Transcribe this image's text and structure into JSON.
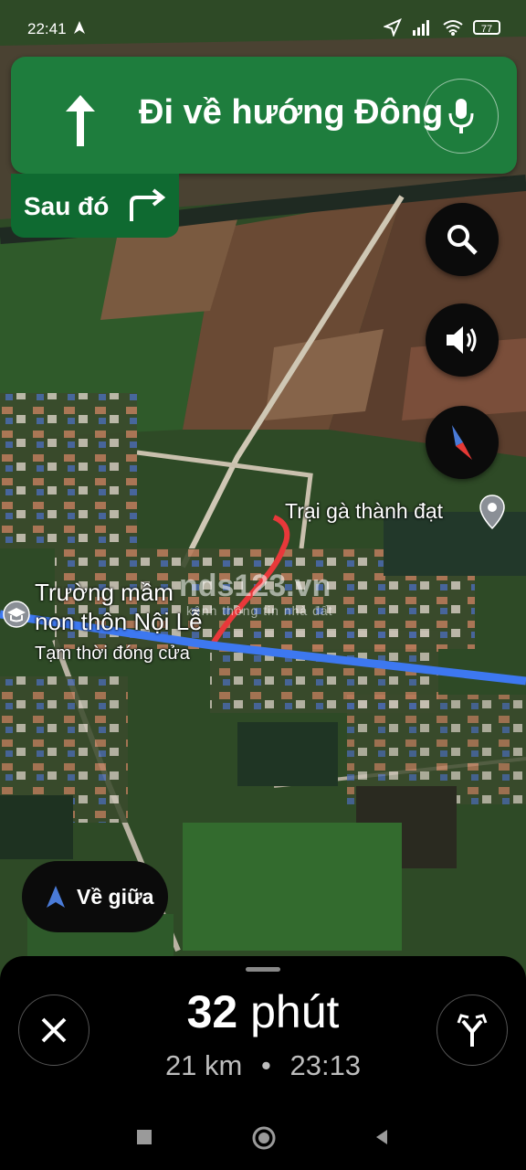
{
  "status_bar": {
    "time": "22:41",
    "battery": "77"
  },
  "banner": {
    "instruction": "Đi về hướng Đông",
    "then_label": "Sau đó"
  },
  "map": {
    "places": [
      {
        "name": "Trại gà thành đạt"
      },
      {
        "name_line1": "Trường mầm",
        "name_line2": "non thôn Nội Lễ",
        "status": "Tạm thời đóng cửa"
      }
    ],
    "watermark": {
      "main": "nds123.vn",
      "tagline": "kênh thông tin nhà đất"
    }
  },
  "recenter": {
    "label": "Về giữa"
  },
  "trip": {
    "duration_number": "32",
    "duration_unit": " phút",
    "distance": "21 km",
    "separator": "•",
    "arrival": "23:13"
  },
  "colors": {
    "banner": "#1e7d3d",
    "then_banner": "#0f6a31",
    "route": "#3d78f0",
    "walk_route": "#e8383a"
  },
  "icons": [
    "navigation-arrow-icon",
    "cellular-signal-icon",
    "wifi-icon",
    "battery-icon",
    "up-arrow-icon",
    "microphone-icon",
    "turn-right-icon",
    "search-icon",
    "volume-icon",
    "compass-icon",
    "place-pin-icon",
    "school-icon",
    "navigation-arrow-icon",
    "close-icon",
    "alternate-route-icon",
    "home-icon",
    "back-icon",
    "recents-icon"
  ]
}
